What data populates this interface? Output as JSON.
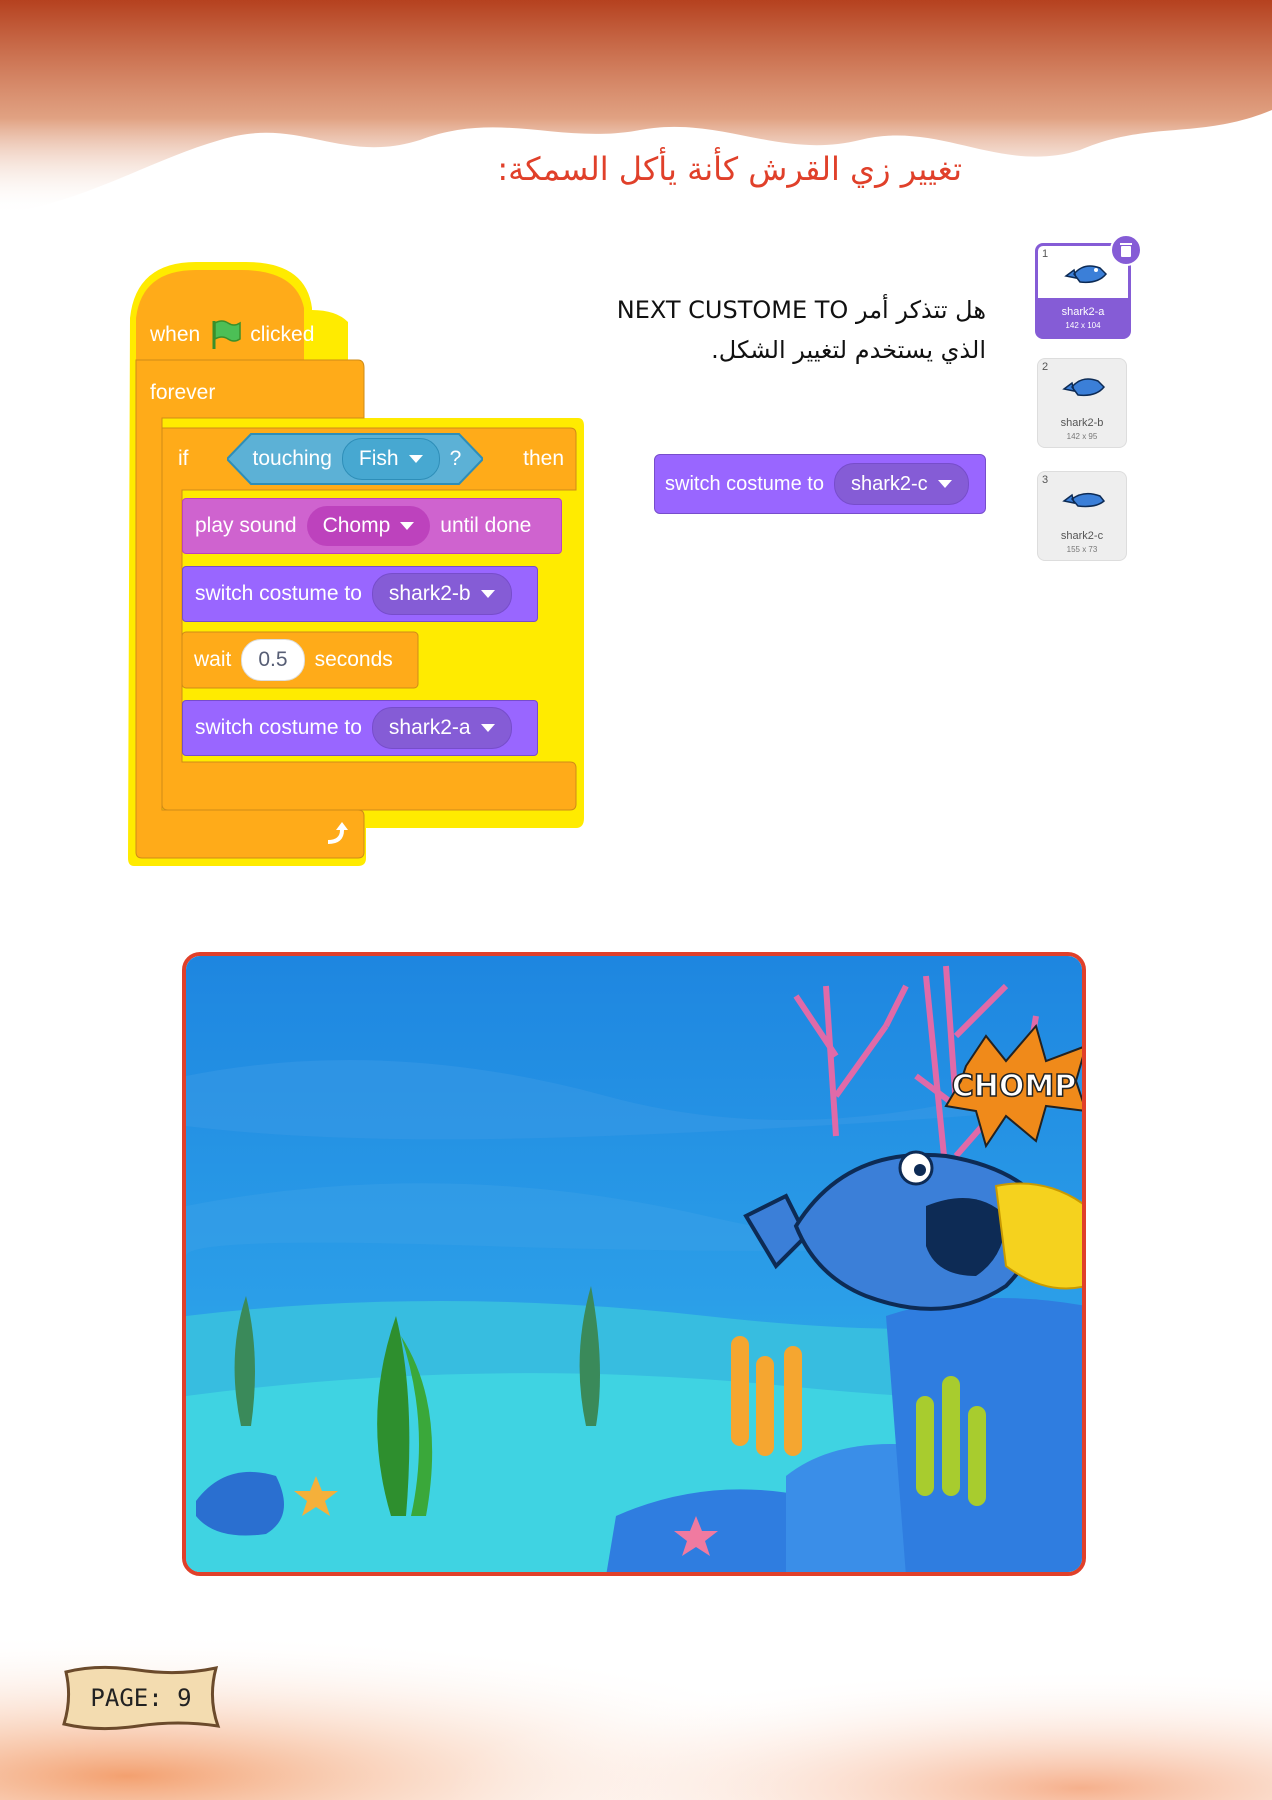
{
  "heading": "تغيير زي القرش كأنة يأكل السمكة:",
  "question": "هل تتذكر أمر NEXT CUSTOME TO الذي يستخدم لتغيير الشكل.",
  "script": {
    "hat": {
      "when": "when",
      "clicked": "clicked"
    },
    "forever": "forever",
    "if": {
      "if": "if",
      "touching": "touching",
      "target": "Fish",
      "q": "?",
      "then": "then"
    },
    "sound": {
      "play": "play sound",
      "name": "Chomp",
      "until": "until done"
    },
    "switch1": {
      "label": "switch costume to",
      "value": "shark2-b"
    },
    "wait": {
      "wait": "wait",
      "value": "0.5",
      "seconds": "seconds"
    },
    "switch2": {
      "label": "switch costume to",
      "value": "shark2-a"
    }
  },
  "standalone_block": {
    "label": "switch costume to",
    "value": "shark2-c"
  },
  "costumes": [
    {
      "num": "1",
      "name": "shark2-a",
      "size": "142 x 104",
      "selected": true
    },
    {
      "num": "2",
      "name": "shark2-b",
      "size": "142 x 95",
      "selected": false
    },
    {
      "num": "3",
      "name": "shark2-c",
      "size": "155 x 73",
      "selected": false
    }
  ],
  "stage": {
    "burst_text": "CHOMP"
  },
  "page_label": "PAGE: 9",
  "colors": {
    "events": "#ffab19",
    "control": "#ffab19",
    "sound": "#cf63cf",
    "looks": "#9966ff",
    "sensing": "#5cb1d6",
    "highlight": "#ffeb00",
    "title": "#e0402a"
  }
}
